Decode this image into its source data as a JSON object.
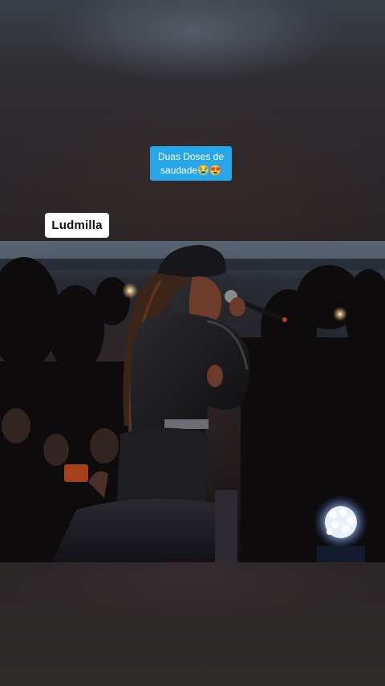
{
  "caption": {
    "line1": "Duas Doses de",
    "line2": "saudade😭😍"
  },
  "name_tag": {
    "label": "Ludmilla"
  },
  "colors": {
    "caption_bg": "#27a7e7",
    "name_tag_bg": "#ffffff",
    "backdrop": "#2a2422"
  },
  "video": {
    "subject": "performer-singing-with-microphone"
  }
}
